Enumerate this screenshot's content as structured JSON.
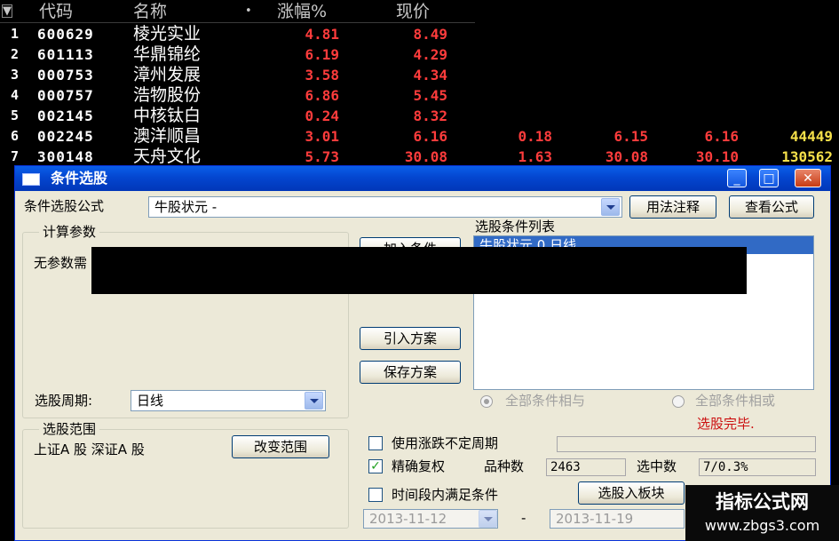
{
  "table": {
    "header": {
      "sort_marker": "▼",
      "code": "代码",
      "name": "名称",
      "dot": "•",
      "change_pct": "涨幅%",
      "price": "现价"
    },
    "rows": [
      {
        "idx": "1",
        "code": "600629",
        "name": "棱光实业",
        "pct": "4.81",
        "price": "8.49",
        "e1": "",
        "e2": "",
        "e3": "",
        "vol": ""
      },
      {
        "idx": "2",
        "code": "601113",
        "name": "华鼎锦纶",
        "pct": "6.19",
        "price": "4.29",
        "e1": "",
        "e2": "",
        "e3": "",
        "vol": ""
      },
      {
        "idx": "3",
        "code": "000753",
        "name": "漳州发展",
        "pct": "3.58",
        "price": "4.34",
        "e1": "",
        "e2": "",
        "e3": "",
        "vol": ""
      },
      {
        "idx": "4",
        "code": "000757",
        "name": "浩物股份",
        "pct": "6.86",
        "price": "5.45",
        "e1": "",
        "e2": "",
        "e3": "",
        "vol": ""
      },
      {
        "idx": "5",
        "code": "002145",
        "name": "中核钛白",
        "pct": "0.24",
        "price": "8.32",
        "e1": "",
        "e2": "",
        "e3": "",
        "vol": ""
      },
      {
        "idx": "6",
        "code": "002245",
        "name": "澳洋顺昌",
        "pct": "3.01",
        "price": "6.16",
        "e1": "0.18",
        "e2": "6.15",
        "e3": "6.16",
        "vol": "44449"
      },
      {
        "idx": "7",
        "code": "300148",
        "name": "天舟文化",
        "pct": "5.73",
        "price": "30.08",
        "e1": "1.63",
        "e2": "30.08",
        "e3": "30.10",
        "vol": "130562"
      }
    ]
  },
  "dialog": {
    "title": "条件选股",
    "formula_label": "条件选股公式",
    "formula_value": "牛股状元 -",
    "usage_btn": "用法注释",
    "view_btn": "查看公式",
    "params_group": "计算参数",
    "no_params": "无参数需",
    "add_btn": "加入条件",
    "cond_list_label": "选股条件列表",
    "cond_item": "牛股状元  0  日线",
    "import_btn": "引入方案",
    "save_btn": "保存方案",
    "period_label": "选股周期:",
    "period_value": "日线",
    "radio_and": "全部条件相与",
    "radio_or": "全部条件相或",
    "status_done": "选股完毕.",
    "range_group": "选股范围",
    "range_value": "上证A 股  深证A 股",
    "change_range_btn": "改变范围",
    "use_irregular": "使用涨跌不定周期",
    "precise_label": "精确复权",
    "check_mark": "✓",
    "variety_label": "品种数",
    "variety_value": "2463",
    "selected_label": "选中数",
    "selected_value": "7/0.3%",
    "time_cond": "时间段内满足条件",
    "to_block_btn": "选股入板块",
    "date_start": "2013-11-12",
    "date_sep": "-",
    "date_end": "2013-11-19",
    "tb_min": "_",
    "tb_max": "□",
    "tb_close": "✕"
  },
  "watermark": {
    "line1": "指标公式网",
    "line2": "www.zbgs3.com"
  },
  "colors": {
    "price_red": "#ff3c3c",
    "volume_yellow": "#f5e04a",
    "title_blue": "#0446d0",
    "status_red": "#cc1010"
  }
}
